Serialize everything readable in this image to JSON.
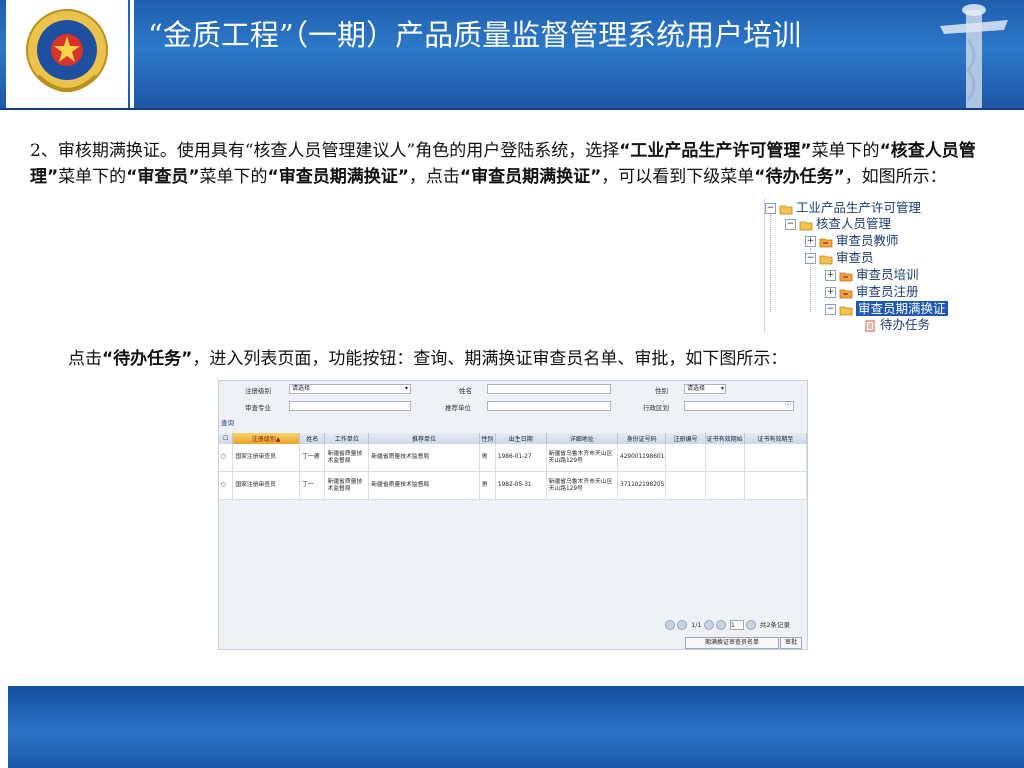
{
  "header": {
    "title": "“金质工程”（一期）产品质量监督管理系统用户培训",
    "emblem_icon": "national-emblem-icon",
    "pillar_icon": "huabiao-pillar-icon",
    "colors": {
      "primary": "#1f5fb0",
      "footer": "#134fa0"
    }
  },
  "paragraph1": {
    "t1": "2、审核期满换证。使用具有“核查人员管理建议人”角色的用户登陆系统，选择",
    "b1": "“工业产品生产许可管理”",
    "t2": "菜单下的",
    "b2": "“核查人员管理”",
    "t3": "菜单下的",
    "b3": "“审查员”",
    "t4": "菜单下的",
    "b4": "“审查员期满换证”",
    "t5": "，点击",
    "b5": "“审查员期满换证”",
    "t6": "，可以看到下级菜单",
    "b6": "“待办任务”",
    "t7": "，如图所示："
  },
  "tree": {
    "nodes": [
      "工业产品生产许可管理",
      "核查人员管理",
      "审查员教师",
      "审查员",
      "审查员培训",
      "审查员注册",
      "审查员期满换证",
      "待办任务"
    ]
  },
  "paragraph2": {
    "t1": "点击",
    "b1": "“待办任务”",
    "t2": "，进入列表页面，功能按钮：查询、期满换证审查员名单、审批，如下图所示："
  },
  "grid": {
    "form": {
      "reg_level_label": "注册级别",
      "reg_level_value": "请选择",
      "name_label": "姓名",
      "gender_label": "性别",
      "gender_value": "请选择",
      "major_label": "审查专业",
      "recommend_label": "推荐单位",
      "region_label": "行政区划"
    },
    "query_label": "查询",
    "columns": [
      "注册级别▲",
      "姓名",
      "工作单位",
      "推荐单位",
      "性别",
      "出生日期",
      "详细地址",
      "身份证号码",
      "注册编号",
      "证书有效期始",
      "证书有效期至"
    ],
    "rows": [
      [
        "国家注册审查员",
        "丁一德",
        "新疆省质量技术监督局",
        "新疆省质量技术监督局",
        "男",
        "1986-01-27",
        "新疆省乌鲁木齐市天山区天山路129号",
        "429001198601271615",
        "",
        "",
        ""
      ],
      [
        "国家注册审查员",
        "丁一",
        "新疆省质量技术监督局",
        "新疆省质量技术监督局",
        "男",
        "1982-05-31",
        "新疆省乌鲁木齐市天山区天山路129号",
        "371102198205310520",
        "",
        "",
        ""
      ]
    ],
    "pager": {
      "page": "1/1",
      "page_input": "1",
      "total": "共2条记录"
    },
    "buttons": {
      "list": "期满换证审查员名单",
      "approve": "审批"
    }
  }
}
